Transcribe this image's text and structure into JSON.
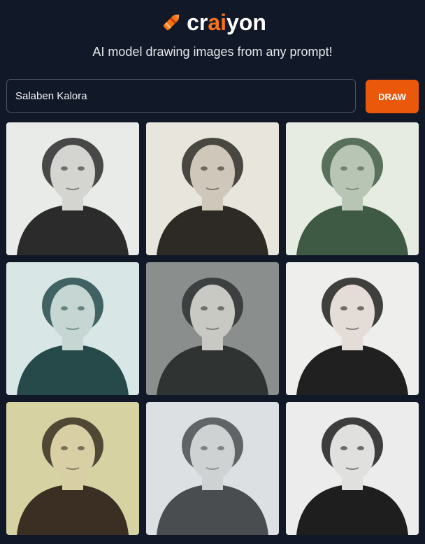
{
  "brand": {
    "name_prefix": "cr",
    "name_accent": "ai",
    "name_suffix": "yon",
    "accent_color": "#f97316",
    "icon": "crayon-icon"
  },
  "tagline": "AI model drawing images from any prompt!",
  "search": {
    "value": "Salaben Kalora",
    "placeholder": ""
  },
  "draw_button": {
    "label": "DRAW",
    "color": "#ea580c"
  },
  "results": [
    {
      "tone": "#e9ebe9",
      "figure": "#2b2b2b",
      "face": "#d4d4d0"
    },
    {
      "tone": "#e8e6dc",
      "figure": "#2d2a26",
      "face": "#cfc8ba"
    },
    {
      "tone": "#e6ece2",
      "figure": "#3f5a44",
      "face": "#b8c4b4"
    },
    {
      "tone": "#d8e6e6",
      "figure": "#264a4a",
      "face": "#c6d6d2"
    },
    {
      "tone": "#8a8e8c",
      "figure": "#2f3332",
      "face": "#c9c9c4"
    },
    {
      "tone": "#eeeeec",
      "figure": "#202020",
      "face": "#e4dcd6"
    },
    {
      "tone": "#d6d2a2",
      "figure": "#3a2f22",
      "face": "#d9cfa4"
    },
    {
      "tone": "#dce0e2",
      "figure": "#4a4d50",
      "face": "#cfd2d3"
    },
    {
      "tone": "#ececec",
      "figure": "#1e1e1e",
      "face": "#e0e0de"
    }
  ]
}
